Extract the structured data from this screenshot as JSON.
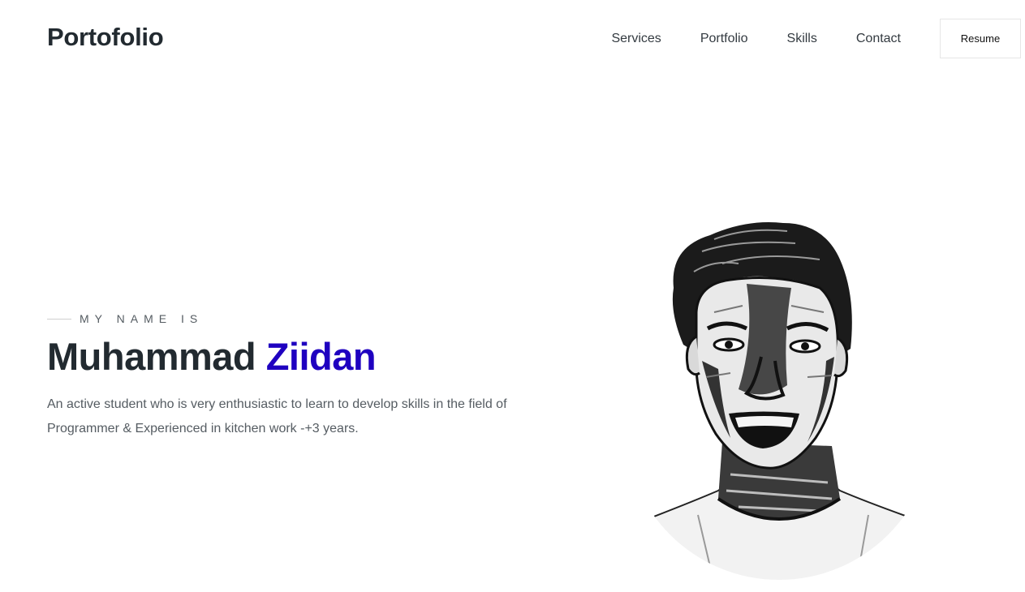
{
  "header": {
    "brand": "Portofolio",
    "nav": [
      "Services",
      "Portfolio",
      "Skills",
      "Contact"
    ],
    "resume_label": "Resume"
  },
  "hero": {
    "eyebrow": "MY NAME IS",
    "first_name": "Muhammad",
    "last_name": "Ziidan",
    "description": "An active student who is very enthusiastic to learn to develop skills in the field of Programmer & Experienced in kitchen work -+3 years.",
    "accent_color": "#1f00c0"
  },
  "portrait": {
    "alt": "sketch portrait"
  }
}
